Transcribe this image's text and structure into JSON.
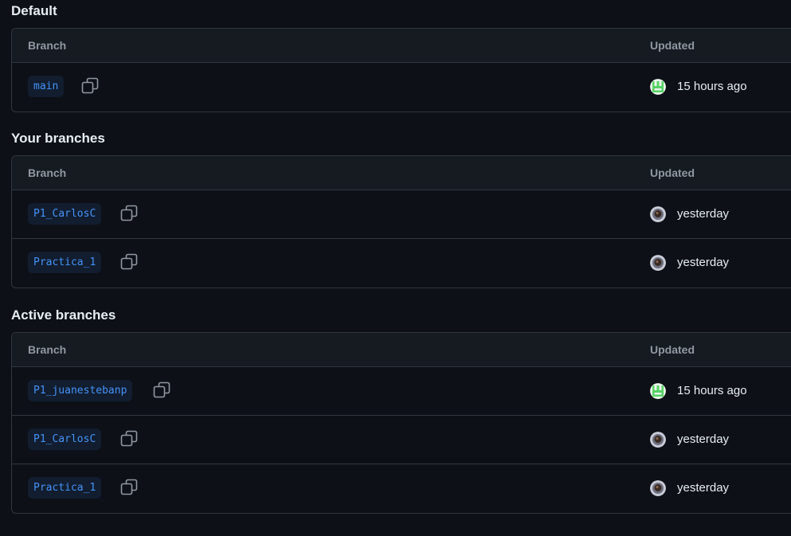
{
  "columns": {
    "branch": "Branch",
    "updated": "Updated"
  },
  "sections": {
    "default": {
      "title": "Default",
      "rows": [
        {
          "branch": "main",
          "updated": "15 hours ago",
          "avatar": "identicon-green-avatar"
        }
      ]
    },
    "yours": {
      "title": "Your branches",
      "rows": [
        {
          "branch": "P1_CarlosC",
          "updated": "yesterday",
          "avatar": "photo-avatar"
        },
        {
          "branch": "Practica_1",
          "updated": "yesterday",
          "avatar": "photo-avatar"
        }
      ]
    },
    "active": {
      "title": "Active branches",
      "rows": [
        {
          "branch": "P1_juanestebanp",
          "updated": "15 hours ago",
          "avatar": "identicon-green-avatar"
        },
        {
          "branch": "P1_CarlosC",
          "updated": "yesterday",
          "avatar": "photo-avatar"
        },
        {
          "branch": "Practica_1",
          "updated": "yesterday",
          "avatar": "photo-avatar"
        }
      ]
    }
  },
  "icons": {
    "copy": "copy-icon"
  },
  "colors": {
    "background": "#0d1117",
    "header_bg": "#161b22",
    "border": "#30363d",
    "branch_chip_bg": "#121d2f",
    "branch_link": "#4493f8",
    "muted_text": "#9198a1",
    "identicon_green": "#56d364"
  }
}
